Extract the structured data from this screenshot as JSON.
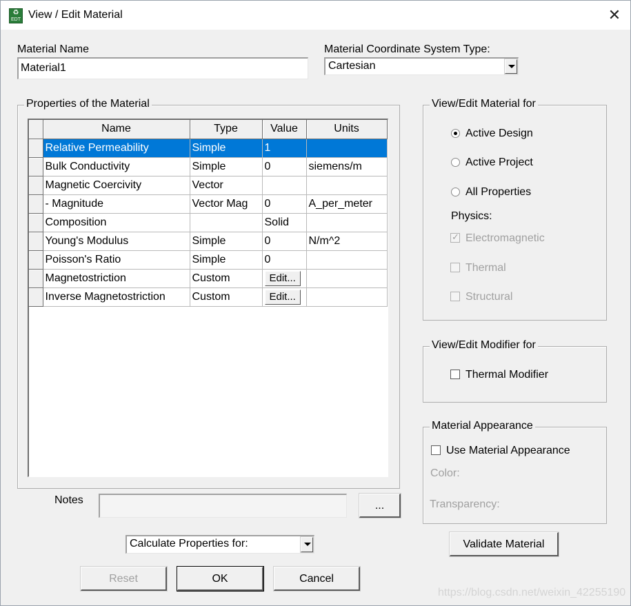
{
  "window": {
    "title": "View / Edit Material",
    "icon_label_top": "♻",
    "icon_label_bottom": "EDT",
    "close_icon": "✕"
  },
  "material_name": {
    "label": "Material Name",
    "value": "Material1"
  },
  "coord_system": {
    "label": "Material Coordinate System Type:",
    "value": "Cartesian"
  },
  "properties": {
    "group_title": "Properties of the Material",
    "columns": [
      "Name",
      "Type",
      "Value",
      "Units"
    ],
    "rows": [
      {
        "name": "Relative Permeability",
        "type": "Simple",
        "value": "1",
        "units": "",
        "selected": true
      },
      {
        "name": "Bulk Conductivity",
        "type": "Simple",
        "value": "0",
        "units": "siemens/m"
      },
      {
        "name": "Magnetic Coercivity",
        "type": "Vector",
        "value": "",
        "units": ""
      },
      {
        "name": "-  Magnitude",
        "type": "Vector Mag",
        "value": "0",
        "units": "A_per_meter"
      },
      {
        "name": "Composition",
        "type": "",
        "value": "Solid",
        "units": ""
      },
      {
        "name": "Young's Modulus",
        "type": "Simple",
        "value": "0",
        "units": "N/m^2"
      },
      {
        "name": "Poisson's Ratio",
        "type": "Simple",
        "value": "0",
        "units": ""
      },
      {
        "name": "Magnetostriction",
        "type": "Custom",
        "value_button": "Edit...",
        "units": ""
      },
      {
        "name": "Inverse Magnetostriction",
        "type": "Custom",
        "value_button": "Edit...",
        "units": ""
      }
    ]
  },
  "view_edit_for": {
    "group_title": "View/Edit Material for",
    "options": [
      "Active Design",
      "Active Project",
      "All Properties"
    ],
    "selected": "Active Design",
    "physics_label": "Physics:",
    "physics": [
      {
        "label": "Electromagnetic",
        "checked": true
      },
      {
        "label": "Thermal",
        "checked": false
      },
      {
        "label": "Structural",
        "checked": false
      }
    ]
  },
  "modifier": {
    "group_title": "View/Edit Modifier for",
    "checkbox_label": "Thermal Modifier"
  },
  "appearance": {
    "group_title": "Material Appearance",
    "checkbox_label": "Use Material Appearance",
    "color_label": "Color:",
    "transparency_label": "Transparency:"
  },
  "notes": {
    "label": "Notes",
    "value": "",
    "browse_label": "..."
  },
  "calculate": {
    "value": "Calculate Properties for:"
  },
  "buttons": {
    "validate": "Validate Material",
    "reset": "Reset",
    "ok": "OK",
    "cancel": "Cancel"
  },
  "watermark": "https://blog.csdn.net/weixin_42255190"
}
